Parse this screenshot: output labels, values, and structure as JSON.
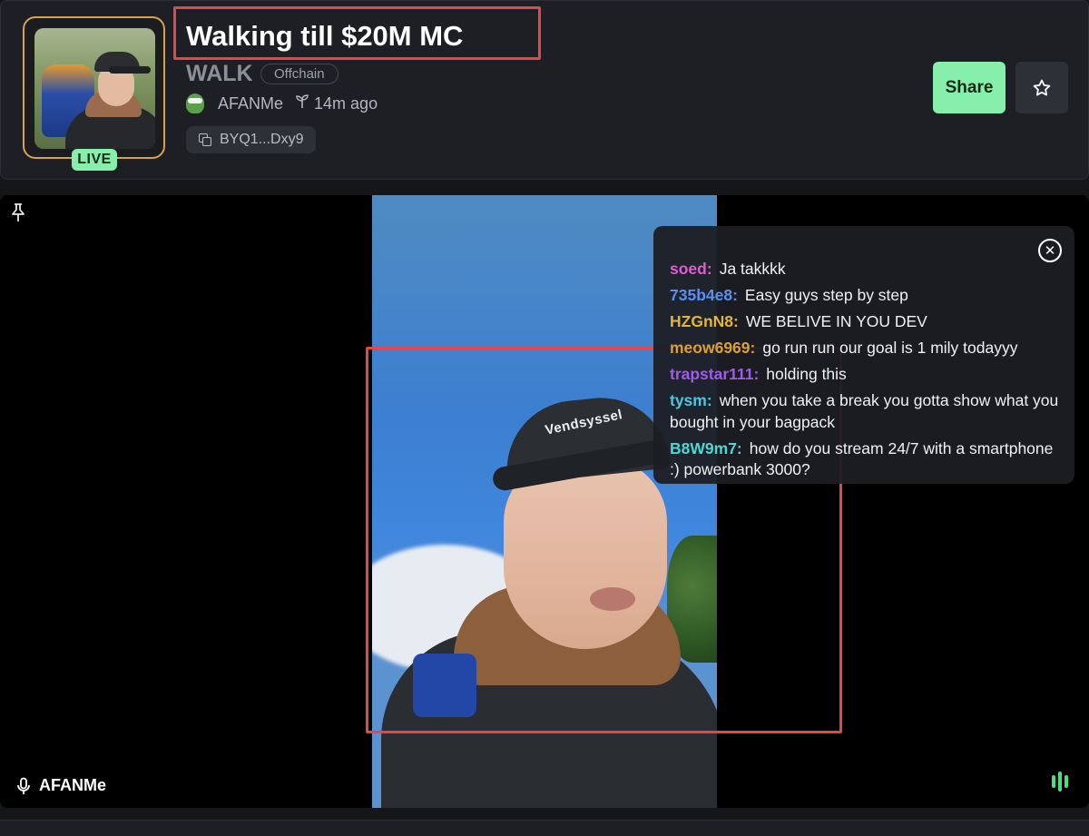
{
  "header": {
    "title": "Walking till $20M MC",
    "ticker": "WALK",
    "tag": "Offchain",
    "creator": "AFANMe",
    "age": "14m ago",
    "address": "BYQ1...Dxy9",
    "live_label": "LIVE",
    "share_label": "Share",
    "accent_color": "#86efac"
  },
  "stream": {
    "speaker_name": "AFANMe",
    "cap_text": "Vendsyssel"
  },
  "chat": {
    "messages": [
      {
        "user": "soed",
        "text": "Ja takkkk",
        "color": "#e25ad0"
      },
      {
        "user": "735b4e8",
        "text": "Easy guys step by step",
        "color": "#5b8ff0"
      },
      {
        "user": "HZGnN8",
        "text": "WE BELIVE IN YOU DEV",
        "color": "#e0b441"
      },
      {
        "user": "meow6969",
        "text": "go run run our goal is 1 mily todayyy",
        "color": "#d9a03a"
      },
      {
        "user": "trapstar111",
        "text": "holding this",
        "color": "#a25ae8"
      },
      {
        "user": "tysm",
        "text": "when you take a break you gotta show what you bought in your bagpack",
        "color": "#4cc7e0"
      },
      {
        "user": "B8W9m7",
        "text": "how do you stream 24/7 with a smartphone :) powerbank 3000?",
        "color": "#4cd8d0"
      }
    ]
  }
}
